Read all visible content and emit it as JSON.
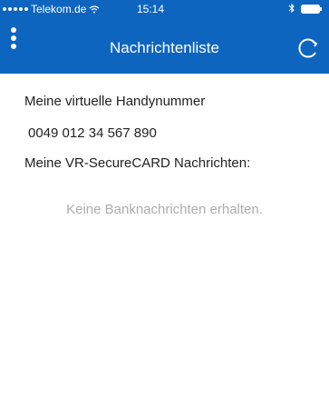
{
  "status_bar": {
    "carrier": "Telekom.de",
    "time": "15:14",
    "signal_icon": "signal-dots-icon",
    "wifi_icon": "wifi-icon",
    "bluetooth_icon": "bluetooth-icon",
    "battery_icon": "battery-icon"
  },
  "header": {
    "title": "Nachrichtenliste",
    "menu_icon": "vertical-ellipsis-icon",
    "refresh_icon": "refresh-icon",
    "background_color": "#0e65bf"
  },
  "content": {
    "virtual_number_label": "Meine virtuelle Handynummer",
    "virtual_number_value": "0049 012 34 567 890",
    "messages_label": "Meine VR-SecureCARD Nachrichten:",
    "empty_message": "Keine Banknachrichten erhalten."
  }
}
